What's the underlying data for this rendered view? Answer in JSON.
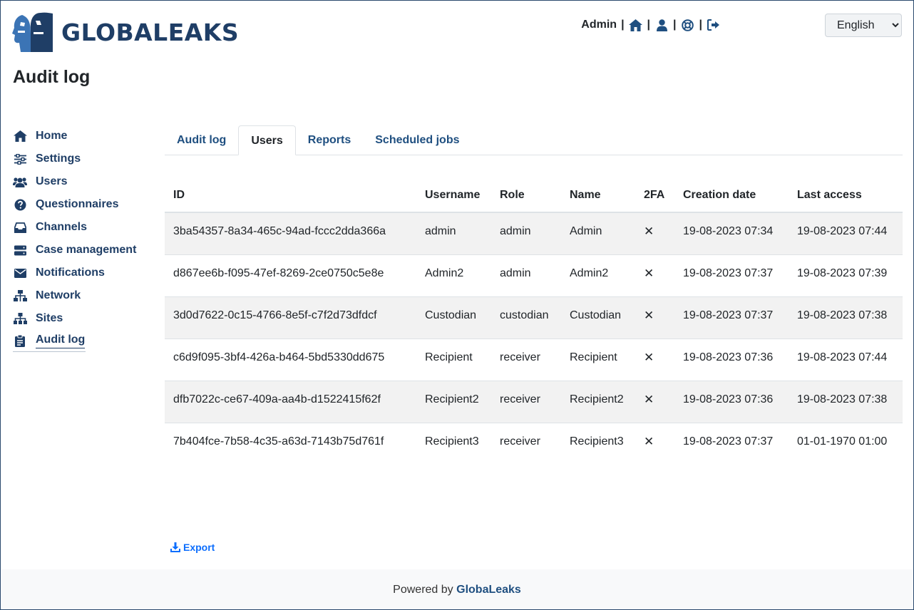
{
  "header": {
    "logo_text": "GLOBALEAKS",
    "user_name": "Admin",
    "nav_icons": [
      "home-icon",
      "user-icon",
      "support-icon",
      "logout-icon"
    ],
    "separator": "|",
    "language": "English"
  },
  "page_title": "Audit log",
  "sidebar": {
    "items": [
      {
        "label": "Home",
        "icon": "home-icon"
      },
      {
        "label": "Settings",
        "icon": "sliders-icon"
      },
      {
        "label": "Users",
        "icon": "users-icon"
      },
      {
        "label": "Questionnaires",
        "icon": "question-icon"
      },
      {
        "label": "Channels",
        "icon": "inbox-icon"
      },
      {
        "label": "Case management",
        "icon": "server-icon"
      },
      {
        "label": "Notifications",
        "icon": "envelope-icon"
      },
      {
        "label": "Network",
        "icon": "network-icon"
      },
      {
        "label": "Sites",
        "icon": "sitemap-icon"
      },
      {
        "label": "Audit log",
        "icon": "clipboard-icon"
      }
    ],
    "active": "Audit log"
  },
  "tabs": [
    "Audit log",
    "Users",
    "Reports",
    "Scheduled jobs"
  ],
  "active_tab": "Users",
  "table": {
    "headers": [
      "ID",
      "Username",
      "Role",
      "Name",
      "2FA",
      "Creation date",
      "Last access"
    ],
    "rows": [
      {
        "id": "3ba54357-8a34-465c-94ad-fccc2dda366a",
        "username": "admin",
        "role": "admin",
        "name": "Admin",
        "twofa": "✕",
        "created": "19-08-2023 07:34",
        "last_access": "19-08-2023 07:44"
      },
      {
        "id": "d867ee6b-f095-47ef-8269-2ce0750c5e8e",
        "username": "Admin2",
        "role": "admin",
        "name": "Admin2",
        "twofa": "✕",
        "created": "19-08-2023 07:37",
        "last_access": "19-08-2023 07:39"
      },
      {
        "id": "3d0d7622-0c15-4766-8e5f-c7f2d73dfdcf",
        "username": "Custodian",
        "role": "custodian",
        "name": "Custodian",
        "twofa": "✕",
        "created": "19-08-2023 07:37",
        "last_access": "19-08-2023 07:38"
      },
      {
        "id": "c6d9f095-3bf4-426a-b464-5bd5330dd675",
        "username": "Recipient",
        "role": "receiver",
        "name": "Recipient",
        "twofa": "✕",
        "created": "19-08-2023 07:36",
        "last_access": "19-08-2023 07:44"
      },
      {
        "id": "dfb7022c-ce67-409a-aa4b-d1522415f62f",
        "username": "Recipient2",
        "role": "receiver",
        "name": "Recipient2",
        "twofa": "✕",
        "created": "19-08-2023 07:36",
        "last_access": "19-08-2023 07:38"
      },
      {
        "id": "7b404fce-7b58-4c35-a63d-7143b75d761f",
        "username": "Recipient3",
        "role": "receiver",
        "name": "Recipient3",
        "twofa": "✕",
        "created": "19-08-2023 07:37",
        "last_access": "01-01-1970 01:00"
      }
    ]
  },
  "export_label": "Export",
  "footer": {
    "prefix": "Powered by",
    "link": "GlobaLeaks"
  },
  "colors": {
    "brand": "#1f3e66",
    "link": "#1f4f80",
    "accent": "#0d6efd"
  }
}
